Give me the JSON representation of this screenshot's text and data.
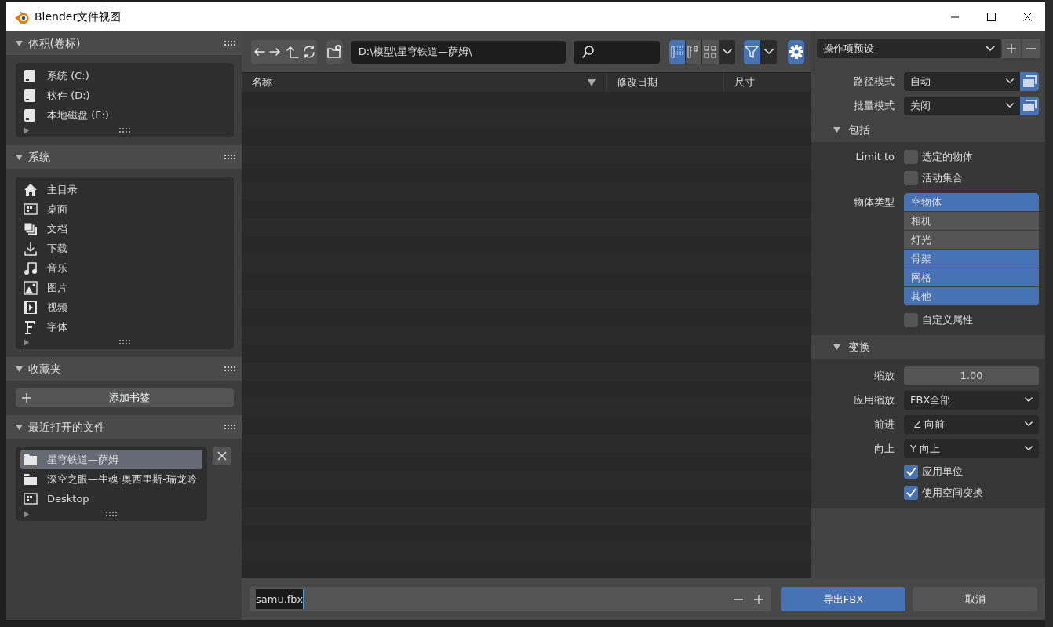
{
  "window": {
    "title": "Blender文件视图"
  },
  "sidebar": [
    {
      "kind": "list",
      "title": "体积(卷标)",
      "expanded": true,
      "items": [
        {
          "kind": "drive",
          "label": "系统 (C:)"
        },
        {
          "kind": "drive",
          "label": "软件 (D:)"
        },
        {
          "kind": "drive",
          "label": "本地磁盘 (E:)"
        }
      ]
    },
    {
      "kind": "list",
      "title": "系统",
      "expanded": true,
      "items": [
        {
          "kind": "home",
          "label": "主目录"
        },
        {
          "kind": "desktop",
          "label": "桌面"
        },
        {
          "kind": "documents",
          "label": "文档"
        },
        {
          "kind": "download",
          "label": "下载"
        },
        {
          "kind": "music",
          "label": "音乐"
        },
        {
          "kind": "picture",
          "label": "图片"
        },
        {
          "kind": "video",
          "label": "视频"
        },
        {
          "kind": "font",
          "label": "字体"
        }
      ]
    },
    {
      "kind": "bookmarks",
      "title": "收藏夹",
      "expanded": true,
      "button": "添加书签"
    },
    {
      "kind": "recent",
      "title": "最近打开的文件",
      "expanded": true,
      "items": [
        {
          "kind": "folder",
          "label": "星穹铁道—萨姆",
          "selected": true
        },
        {
          "kind": "folder",
          "label": "深空之眼—生魂·奥西里斯-瑞龙吟",
          "selected": false
        },
        {
          "kind": "desktop",
          "label": "Desktop",
          "selected": false
        }
      ]
    }
  ],
  "toolbar": {
    "path": "D:\\模型\\星穹铁道—萨姆\\",
    "display_modes": [
      {
        "kind": "vertical-list",
        "selected": true
      },
      {
        "kind": "horizontal-list",
        "selected": false
      },
      {
        "kind": "thumbnails",
        "selected": false
      }
    ],
    "filter": {
      "selected": true
    },
    "settings": {
      "selected": true
    }
  },
  "columns": [
    {
      "label": "名称",
      "sorted": true
    },
    {
      "label": "修改日期",
      "sorted": false
    },
    {
      "label": "尺寸",
      "sorted": false
    }
  ],
  "operator": {
    "preset": "操作项预设",
    "rows": [
      {
        "kind": "select-button",
        "label": "路径模式",
        "value": "自动"
      },
      {
        "kind": "select-button",
        "label": "批量模式",
        "value": "关闭"
      }
    ],
    "sections": [
      {
        "title": "包括",
        "expanded": true,
        "rows": [
          {
            "kind": "checkbox",
            "label": "Limit to",
            "text": "选定的物体",
            "checked": false
          },
          {
            "kind": "checkbox",
            "text": "活动集合",
            "checked": false
          },
          {
            "kind": "toggles",
            "label": "物体类型",
            "options": [
              {
                "label": "空物体",
                "selected": true
              },
              {
                "label": "相机",
                "selected": false
              },
              {
                "label": "灯光",
                "selected": false
              },
              {
                "label": "骨架",
                "selected": true
              },
              {
                "label": "网格",
                "selected": true
              },
              {
                "label": "其他",
                "selected": true
              }
            ]
          },
          {
            "kind": "checkbox",
            "text": "自定义属性",
            "checked": false
          }
        ]
      },
      {
        "title": "变换",
        "expanded": true,
        "rows": [
          {
            "kind": "number",
            "label": "缩放",
            "value": "1.00"
          },
          {
            "kind": "select",
            "label": "应用缩放",
            "value": "FBX全部"
          },
          {
            "kind": "select",
            "label": "前进",
            "value": "-Z 向前"
          },
          {
            "kind": "select",
            "label": "向上",
            "value": "Y 向上"
          },
          {
            "kind": "checkbox",
            "text": "应用单位",
            "checked": true
          },
          {
            "kind": "checkbox",
            "text": "使用空间变换",
            "checked": true
          }
        ]
      }
    ]
  },
  "footer": {
    "filename": "samu.fbx",
    "confirm": "导出FBX",
    "cancel": "取消"
  }
}
